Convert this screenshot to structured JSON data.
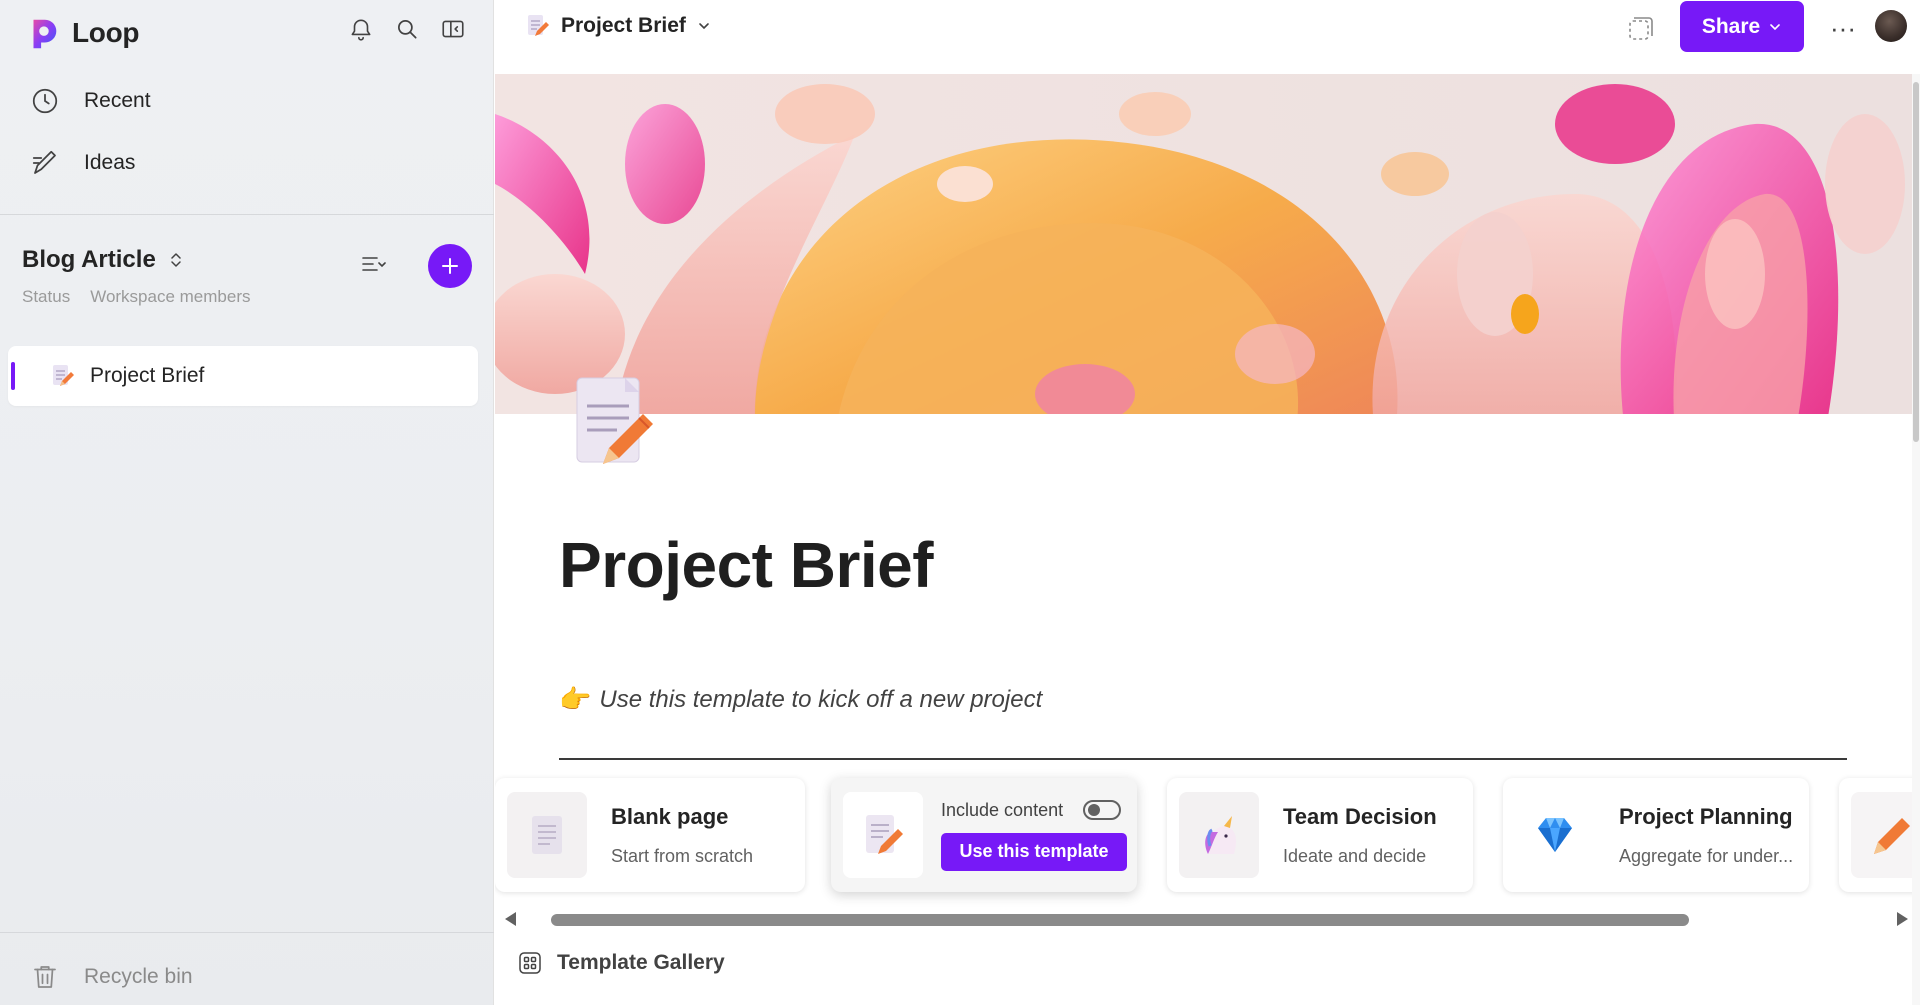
{
  "app": {
    "name": "Loop"
  },
  "sidebar": {
    "nav": [
      {
        "label": "Recent",
        "icon": "clock-icon"
      },
      {
        "label": "Ideas",
        "icon": "pen-note-icon"
      }
    ],
    "workspace": {
      "title": "Blog Article",
      "status_label": "Status",
      "members_label": "Workspace members"
    },
    "pages": [
      {
        "label": "Project Brief",
        "icon": "page-pencil-icon",
        "selected": true
      }
    ],
    "recycle_label": "Recycle bin"
  },
  "topbar": {
    "breadcrumb": "Project Brief",
    "share_label": "Share",
    "more_label": "···"
  },
  "page": {
    "title": "Project Brief",
    "tagline_emoji": "👉",
    "tagline": "Use this template to kick off a new project"
  },
  "templates": [
    {
      "title": "Blank page",
      "subtitle": "Start from scratch",
      "icon": "blank-page-icon"
    },
    {
      "include_label": "Include content",
      "include_on": false,
      "button_label": "Use this template",
      "icon": "page-pencil-icon"
    },
    {
      "title": "Team Decision",
      "subtitle": "Ideate and decide",
      "icon": "unicorn-icon"
    },
    {
      "title": "Project Planning",
      "subtitle": "Aggregate for under...",
      "icon": "diamond-icon"
    }
  ],
  "gallery_label": "Template Gallery",
  "colors": {
    "accent": "#7719f7",
    "sidebar_bg": "#eef0f3"
  }
}
